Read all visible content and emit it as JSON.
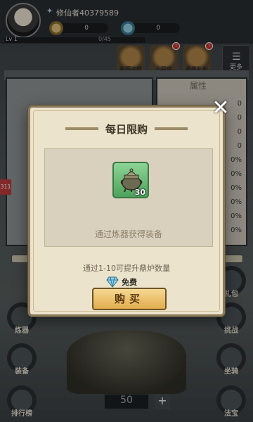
{
  "hud": {
    "player_name": "修仙者40379589",
    "coins": "0",
    "gems": "0",
    "level": "Lv 1",
    "exp": "0/45"
  },
  "top_menu": [
    {
      "label": "新服冲榜"
    },
    {
      "label": "小程序",
      "badge": "!"
    },
    {
      "label": "超值礼包",
      "badge": "!"
    }
  ],
  "menu_button_label": "更多",
  "attribute_panel": {
    "title": "属性",
    "values": [
      "0",
      "0",
      "0",
      "0",
      "0%",
      "0%",
      "0%",
      "0%",
      "0%",
      "0%"
    ]
  },
  "left_badge": "311",
  "side_buttons": {
    "left": [
      "炼器",
      "装备",
      "排行榜"
    ],
    "right": [
      "礼包",
      "挑战",
      "坐骑",
      "法宝"
    ]
  },
  "furnace_count": "50",
  "modal": {
    "title": "每日限购",
    "item_count": "30",
    "item_desc": "通过炼器获得装备",
    "hint": "通过1-10可提升鼎炉数量",
    "price": "免费",
    "buy_label": "购买",
    "close_label": "✕"
  }
}
